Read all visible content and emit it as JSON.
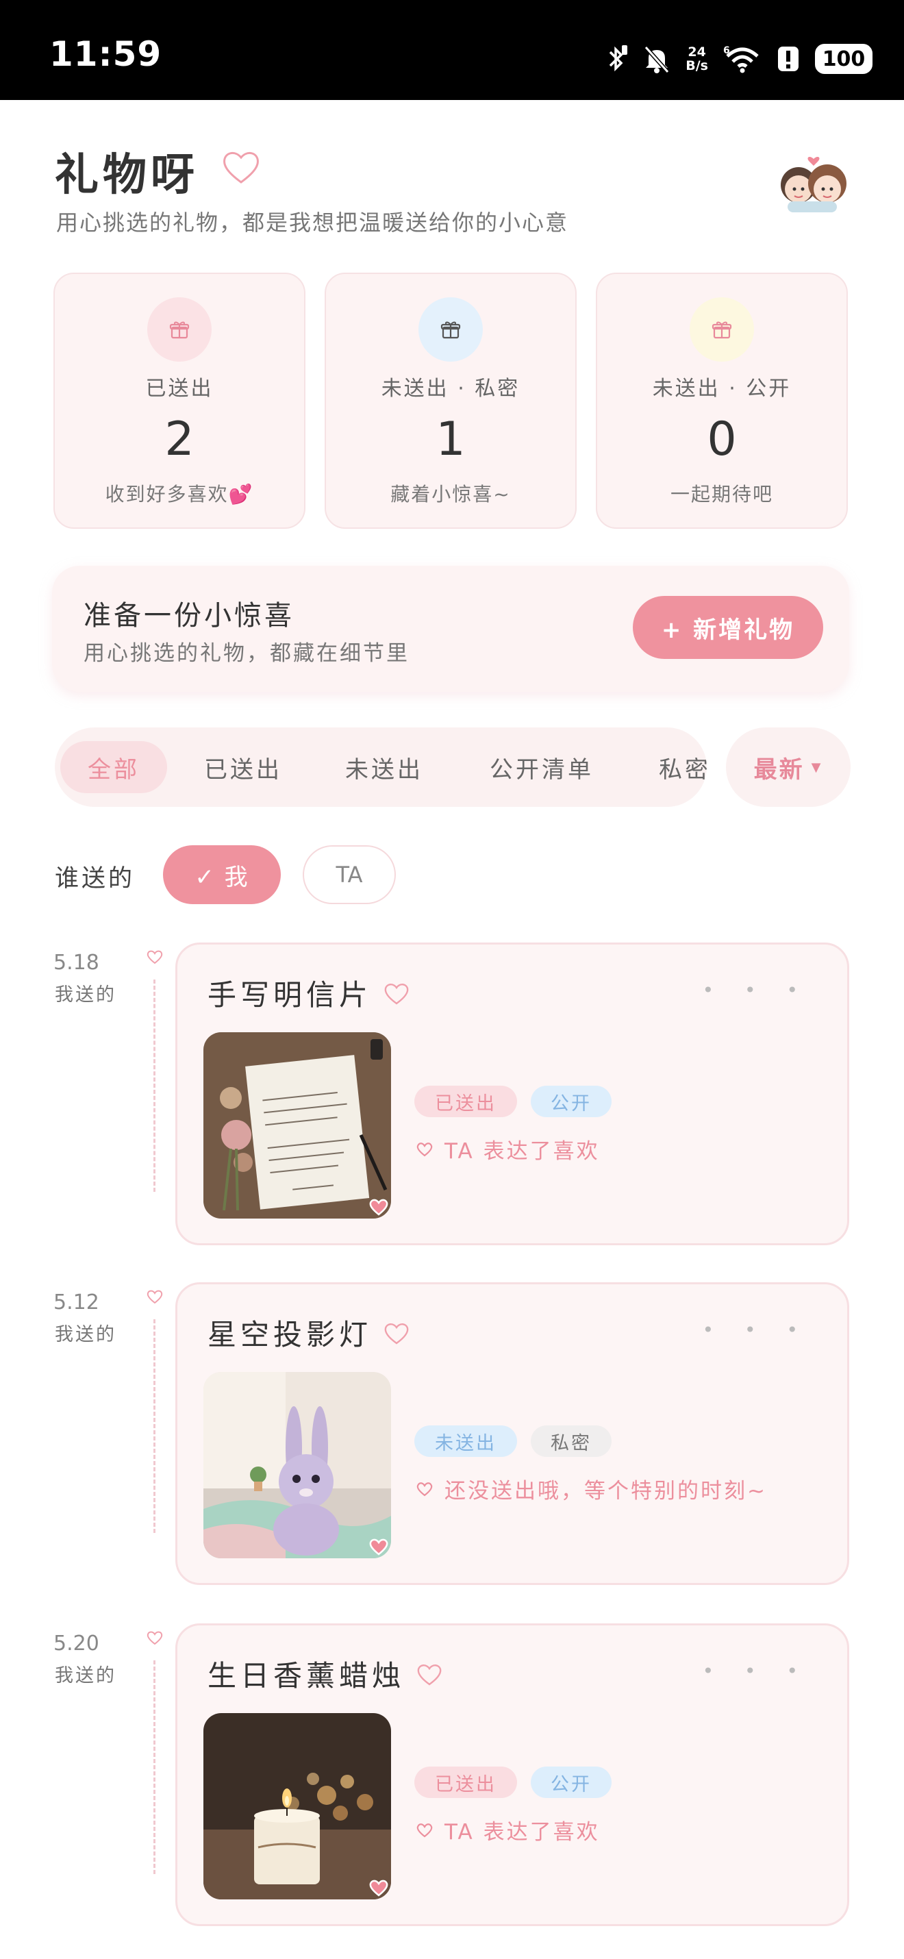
{
  "status_bar": {
    "time": "11:59",
    "network_speed_top": "24",
    "network_speed_bottom": "B/s",
    "network_type": "6",
    "battery": "100",
    "icons": [
      "bluetooth-icon",
      "mute-icon",
      "wifi-icon",
      "alert-icon",
      "battery-icon"
    ]
  },
  "header": {
    "title": "礼物呀",
    "subtitle": "用心挑选的礼物，都是我想把温暖送给你的小心意",
    "icons": [
      "heart-outline-icon",
      "couple-avatar"
    ]
  },
  "stats": [
    {
      "label": "已送出",
      "value": "2",
      "caption": "收到好多喜欢💕",
      "icon": "gift-icon",
      "icon_bg": "#fbe2e5"
    },
    {
      "label": "未送出 · 私密",
      "value": "1",
      "caption": "藏着小惊喜~",
      "icon": "gift-icon",
      "icon_bg": "#e4f1fc"
    },
    {
      "label": "未送出 · 公开",
      "value": "0",
      "caption": "一起期待吧",
      "icon": "gift-icon",
      "icon_bg": "#fdf8e0"
    }
  ],
  "promo": {
    "heading": "准备一份小惊喜",
    "subheading": "用心挑选的礼物，都藏在细节里",
    "button_label": "+ 新增礼物"
  },
  "tabs": {
    "items": [
      "全部",
      "已送出",
      "未送出",
      "公开清单",
      "私密"
    ],
    "active_index": 0
  },
  "sort": {
    "label": "最新",
    "icon": "caret-down-icon"
  },
  "who_filter": {
    "label": "谁送的",
    "options": [
      "✓ 我",
      "TA"
    ],
    "selected_index": 0
  },
  "gifts": [
    {
      "date": "5.18",
      "giver": "我送的",
      "name": "手写明信片",
      "tags": [
        "已送出",
        "公开"
      ],
      "note": "TA 表达了喜欢",
      "image": "handwritten-postcard-photo"
    },
    {
      "date": "5.12",
      "giver": "我送的",
      "name": "星空投影灯",
      "tags": [
        "未送出",
        "私密"
      ],
      "note": "还没送出哦，等个特别的时刻~",
      "image": "bunny-plush-photo"
    },
    {
      "date": "5.20",
      "giver": "我送的",
      "name": "生日香薰蜡烛",
      "tags": [
        "已送出",
        "公开"
      ],
      "note": "TA 表达了喜欢",
      "image": "aroma-candle-photo"
    }
  ],
  "colors": {
    "accent": "#ef929e",
    "card_bg": "#fdf3f3",
    "sent_tag": "#fadde1",
    "public_tag": "#ddeefc"
  }
}
